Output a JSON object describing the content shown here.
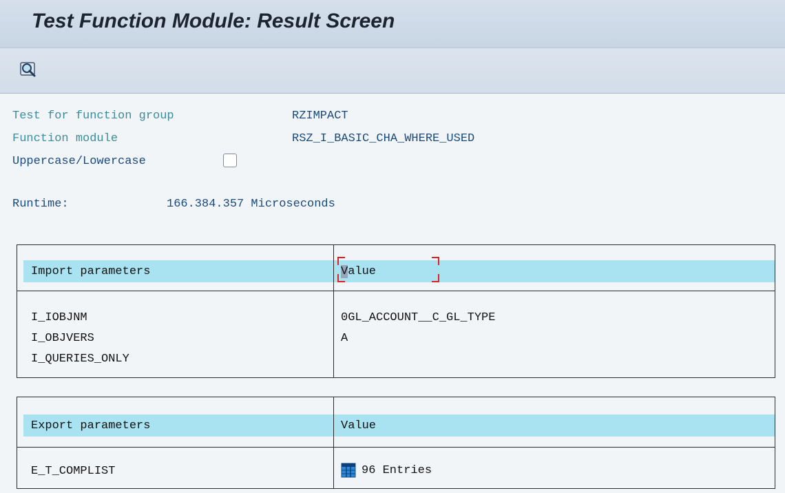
{
  "header": {
    "title": "Test Function Module: Result Screen"
  },
  "toolbar": {
    "buttons": [
      {
        "icon": "magnifier-icon"
      }
    ]
  },
  "info": {
    "function_group_label": "Test for function group",
    "function_group_value": "RZIMPACT",
    "function_module_label": "Function module",
    "function_module_value": "RSZ_I_BASIC_CHA_WHERE_USED",
    "case_label": "Uppercase/Lowercase",
    "case_checked": false
  },
  "runtime": {
    "label": "Runtime:",
    "value": "166.384.357 Microseconds"
  },
  "import_table": {
    "col_param": "Import parameters",
    "col_value_first": "V",
    "col_value_rest": "alue",
    "rows": [
      {
        "name": "I_IOBJNM",
        "value": "0GL_ACCOUNT__C_GL_TYPE"
      },
      {
        "name": "I_OBJVERS",
        "value": "A"
      },
      {
        "name": "I_QUERIES_ONLY",
        "value": ""
      }
    ]
  },
  "export_table": {
    "col_param": "Export parameters",
    "col_value": "Value",
    "rows": [
      {
        "name": "E_T_COMPLIST",
        "value": "96 Entries",
        "icon": "table-icon"
      }
    ]
  },
  "colors": {
    "header_band": "#a9e2f0",
    "label_teal": "#3e8c99",
    "value_blue": "#1a4a7c"
  }
}
